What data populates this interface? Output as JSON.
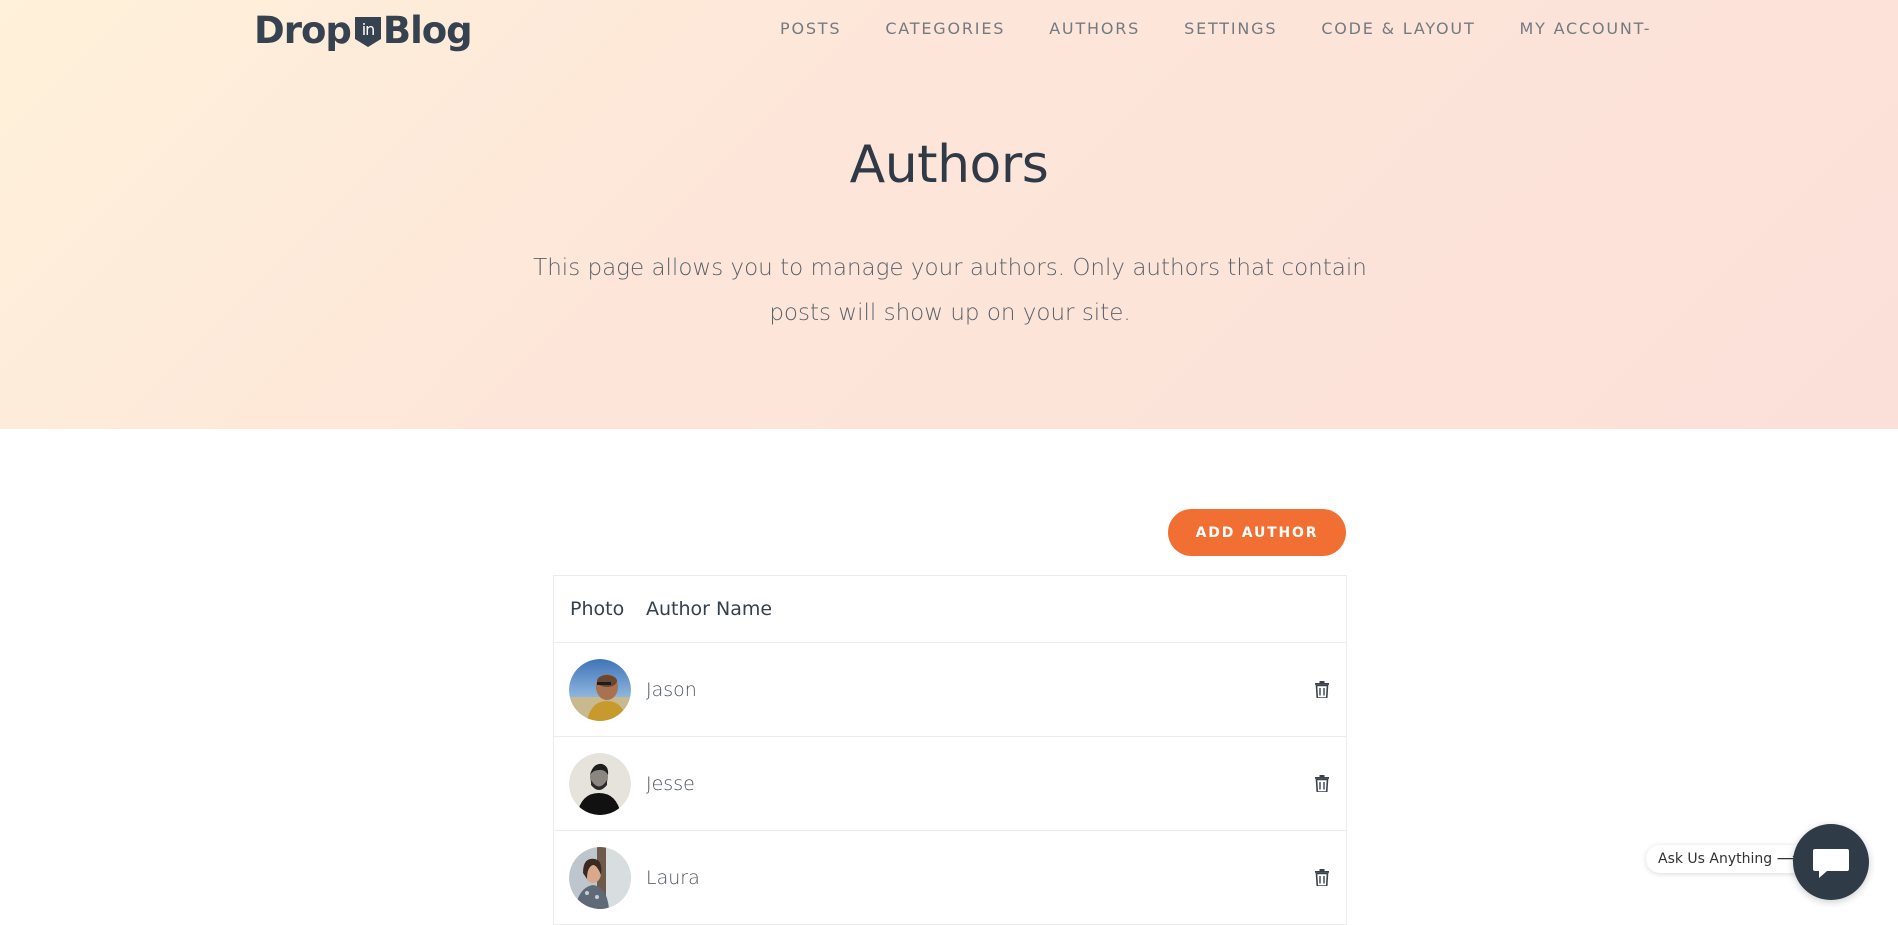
{
  "brand": {
    "logo_left": "Drop",
    "logo_badge": "in",
    "logo_right": "Blog"
  },
  "nav": {
    "items": [
      "POSTS",
      "CATEGORIES",
      "AUTHORS",
      "SETTINGS",
      "CODE & LAYOUT",
      "MY ACCOUNT-"
    ]
  },
  "hero": {
    "title": "Authors",
    "description": "This page allows you to manage your authors. Only authors that contain posts will show up on your site."
  },
  "actions": {
    "add_author_label": "ADD AUTHOR"
  },
  "table": {
    "columns": [
      "Photo",
      "Author Name"
    ],
    "rows": [
      {
        "name": "Jason",
        "avatar_icon": "author-photo-jason"
      },
      {
        "name": "Jesse",
        "avatar_icon": "author-photo-jesse"
      },
      {
        "name": "Laura",
        "avatar_icon": "author-photo-laura"
      }
    ],
    "row_action_icon": "trash-icon"
  },
  "chat": {
    "prompt": "Ask Us Anything ⟶",
    "icon": "chat-icon"
  },
  "colors": {
    "accent": "#f26f33",
    "dark": "#2f3b47",
    "hero_start": "#fff1da",
    "hero_end": "#fbe0d9"
  }
}
